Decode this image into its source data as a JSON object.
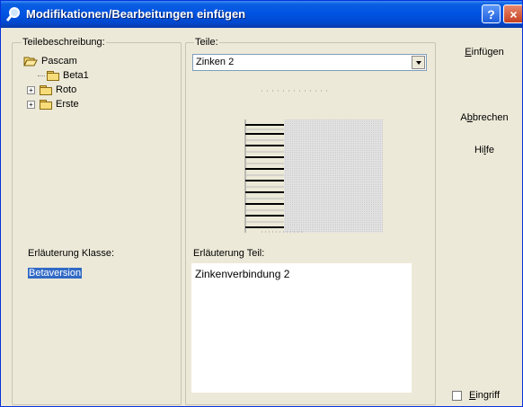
{
  "window": {
    "title": "Modifikationen/Bearbeitungen einfügen",
    "help_glyph": "?",
    "close_glyph": "×"
  },
  "teilebeschreibung": {
    "label": "Teilebeschreibung:",
    "tree": [
      {
        "label": "Pascam",
        "expanded": true,
        "icon": "open-folder-icon"
      },
      {
        "label": "Beta1",
        "icon": "folder-icon"
      },
      {
        "label": "Roto",
        "collapsed": true,
        "icon": "folder-icon"
      },
      {
        "label": "Erste",
        "collapsed": true,
        "icon": "folder-icon"
      }
    ],
    "erlaeuterung_label": "Erläuterung Klasse:",
    "erlaeuterung_value": "Betaversion"
  },
  "teile": {
    "label": "Teile:",
    "selected": "Zinken 2",
    "erlaeuterung_label": "Erläuterung Teil:",
    "erlaeuterung_value": "Zinkenverbindung 2"
  },
  "buttons": {
    "einfuegen": {
      "pre": "",
      "accel": "E",
      "post": "infügen"
    },
    "abbrechen": {
      "pre": "A",
      "accel": "b",
      "post": "brechen"
    },
    "hilfe": {
      "pre": "Hi",
      "accel": "l",
      "post": "fe"
    }
  },
  "eingriff": {
    "accel": "E",
    "rest": "ingriff",
    "checked": false
  }
}
